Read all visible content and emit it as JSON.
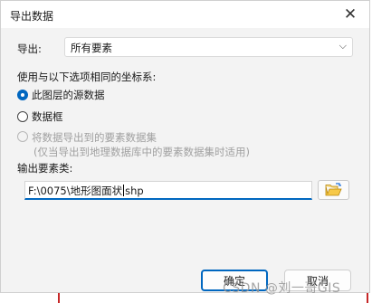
{
  "dialog": {
    "title": "导出数据",
    "close_glyph": "✕",
    "export_label": "导出:",
    "export_value": "所有要素",
    "coord_label": "使用与以下选项相同的坐标系:",
    "radios": [
      {
        "label": "此图层的源数据",
        "checked": true,
        "disabled": false
      },
      {
        "label": "数据框",
        "checked": false,
        "disabled": false
      },
      {
        "label": "将数据导出到的要素数据集",
        "sub": "(仅当导出到地理数据库中的要素数据集时适用)",
        "checked": false,
        "disabled": true
      }
    ],
    "output_label": "输出要素类:",
    "output_path_before": "F:\\0075\\地形图面状",
    "output_path_after": "shp",
    "ok_label": "确定",
    "cancel_label": "取消"
  },
  "watermark": "CSDN @刘一哥GIS",
  "colors": {
    "accent": "#0067c0",
    "dialog_bg": "#f3f3f3"
  }
}
